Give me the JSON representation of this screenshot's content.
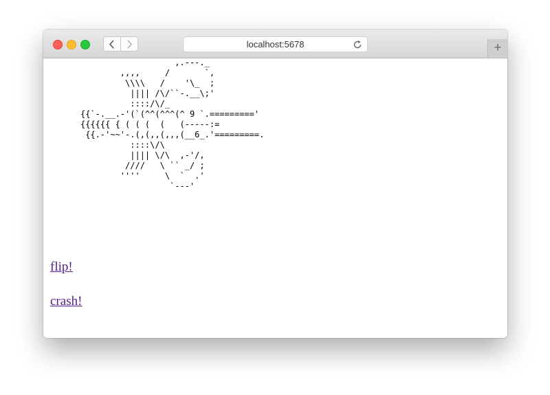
{
  "browser": {
    "url": "localhost:5678",
    "back_icon": "chevron-left-icon",
    "forward_icon": "chevron-right-icon",
    "reload_icon": "reload-icon",
    "new_tab_label": "+"
  },
  "page": {
    "ascii_art": "                   ,.---._\n        ,,,,     /       `,\n         \\\\\\\\   /    '\\_  ;\n          |||| /\\/``-.__\\;'\n          ::::/\\/_\n{{`-.__.-'(`(^^(^^^(^ 9 `.========='\n{{{{{{ { ( ( (  (   (-----:=\n {{.-'~~'-.(,(,,(,,,(__6_.'=========.\n          ::::\\/\\\n          |||| \\/\\  ,-'/,\n         ////   \\ `` _/ ;\n        ''''     \\  `  .'\n                  `---'",
    "links": [
      {
        "label": "flip!"
      },
      {
        "label": "crash!"
      }
    ]
  },
  "colors": {
    "link_visited": "#551a8b",
    "close": "#fe5f57",
    "minimize": "#febc2e",
    "maximize": "#28c840"
  }
}
